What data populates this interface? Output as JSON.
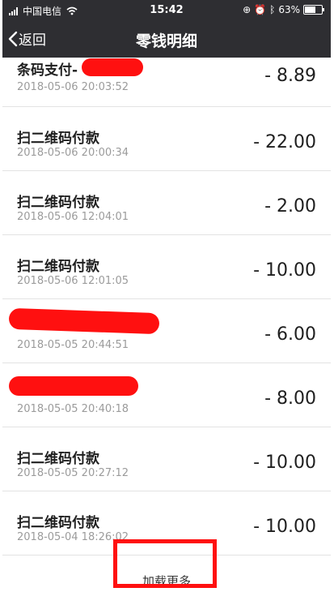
{
  "status_bar": {
    "carrier": "中国电信",
    "time": "15:42",
    "battery": "63%",
    "battery_level": 0.63
  },
  "nav": {
    "back_label": "返回",
    "title": "零钱明细"
  },
  "transactions": [
    {
      "title": "条码支付-",
      "time": "2018-05-06 20:03:52",
      "amount": "- 8.89",
      "redacted": true
    },
    {
      "title": "扫二维码付款",
      "time": "2018-05-06 20:00:34",
      "amount": "- 22.00"
    },
    {
      "title": "扫二维码付款",
      "time": "2018-05-06 12:04:01",
      "amount": "- 2.00"
    },
    {
      "title": "扫二维码付款",
      "time": "2018-05-06 12:01:05",
      "amount": "- 10.00"
    },
    {
      "title": "",
      "time": "2018-05-05 20:44:51",
      "amount": "- 6.00",
      "redacted": true
    },
    {
      "title": "",
      "time": "2018-05-05 20:40:18",
      "amount": "- 8.00",
      "redacted": true
    },
    {
      "title": "扫二维码付款",
      "time": "2018-05-05 20:27:12",
      "amount": "- 10.00"
    },
    {
      "title": "扫二维码付款",
      "time": "2018-05-04 18:26:02",
      "amount": "- 10.00"
    }
  ],
  "load_more_label": "加载更多",
  "colors": {
    "header": "#2e2e32",
    "redaction": "#ff1010"
  }
}
